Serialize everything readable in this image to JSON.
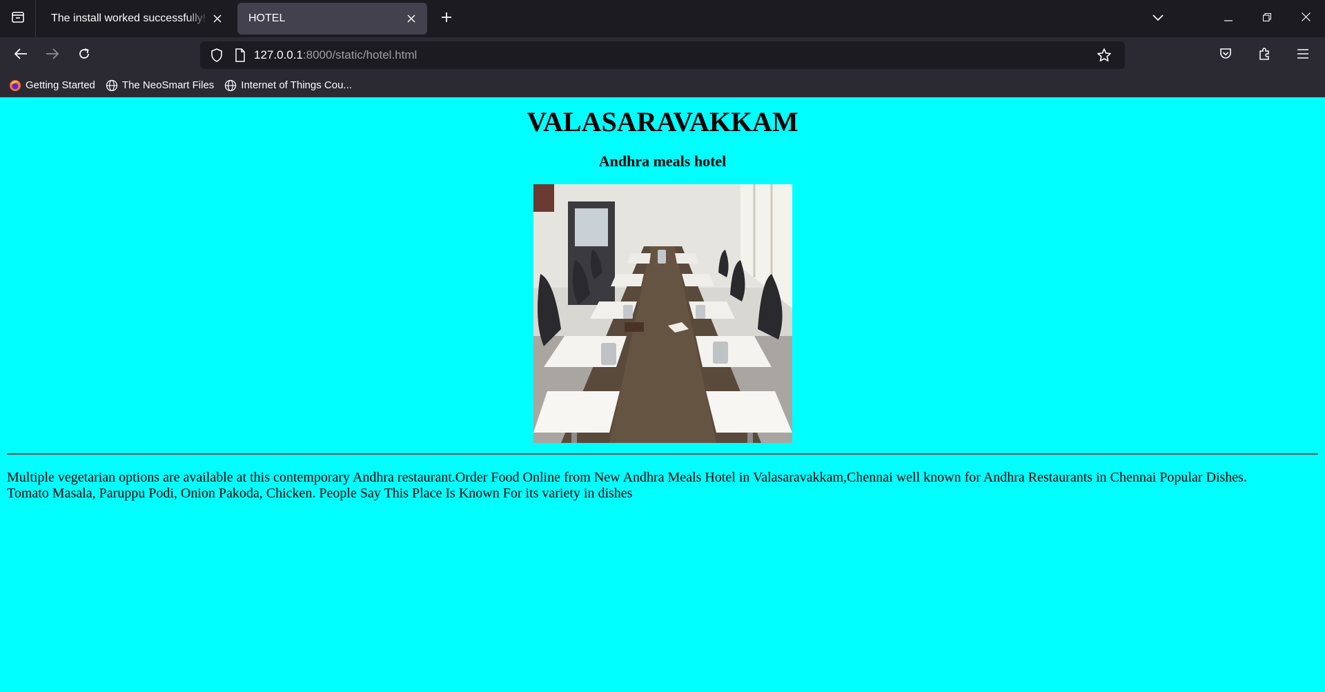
{
  "browser": {
    "tabs": [
      {
        "title": "The install worked successfully! Congratulations!",
        "active": false
      },
      {
        "title": "HOTEL",
        "active": true
      }
    ],
    "url": {
      "host": "127.0.0.1",
      "rest": ":8000/static/hotel.html"
    },
    "bookmarks": [
      {
        "label": "Getting Started",
        "icon": "firefox-icon"
      },
      {
        "label": "The NeoSmart Files",
        "icon": "globe-icon"
      },
      {
        "label": "Internet of Things Cou...",
        "icon": "globe-icon"
      }
    ]
  },
  "page": {
    "title": "VALASARAVAKKAM",
    "subtitle": "Andhra meals hotel",
    "image_alt": "restaurant dining tables",
    "description_line1": "Multiple vegetarian options are available at this contemporary Andhra restaurant.Order Food Online from New Andhra Meals Hotel in Valasaravakkam,Chennai well known for Andhra Restaurants in Chennai Popular Dishes.",
    "description_line2": "Tomato Masala, Paruppu Podi, Onion Pakoda, Chicken. People Say This Place Is Known For its variety in dishes"
  },
  "colors": {
    "page_background": "#00ffff",
    "chrome_dark": "#1c1b22",
    "chrome_toolbar": "#2b2a33",
    "active_tab": "#42414d"
  }
}
